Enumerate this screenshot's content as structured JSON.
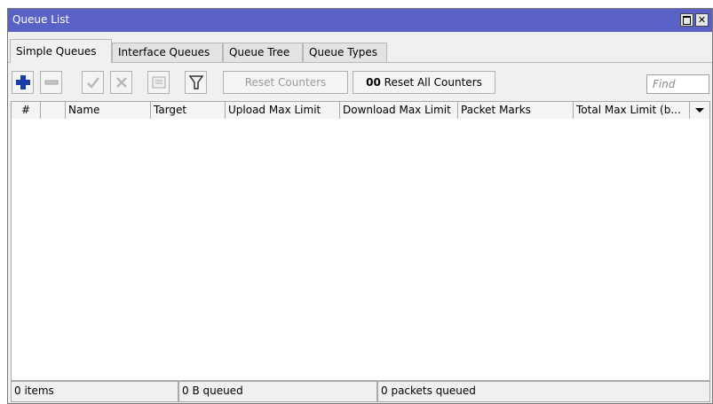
{
  "window": {
    "title": "Queue List"
  },
  "tabs": [
    {
      "label": "Simple Queues",
      "active": true
    },
    {
      "label": "Interface Queues",
      "active": false
    },
    {
      "label": "Queue Tree",
      "active": false
    },
    {
      "label": "Queue Types",
      "active": false
    }
  ],
  "toolbar": {
    "reset_counters": "Reset Counters",
    "reset_all_prefix": "00",
    "reset_all_counters": "Reset All Counters",
    "find_placeholder": "Find"
  },
  "table": {
    "columns": [
      "#",
      "",
      "Name",
      "Target",
      "Upload Max Limit",
      "Download Max Limit",
      "Packet Marks",
      "Total Max Limit (b..."
    ],
    "rows": []
  },
  "status": {
    "items": "0 items",
    "queued_bytes": "0 B queued",
    "queued_packets": "0 packets queued"
  },
  "colors": {
    "titlebar": "#5b62c6",
    "add_icon": "#1a3ea8"
  }
}
